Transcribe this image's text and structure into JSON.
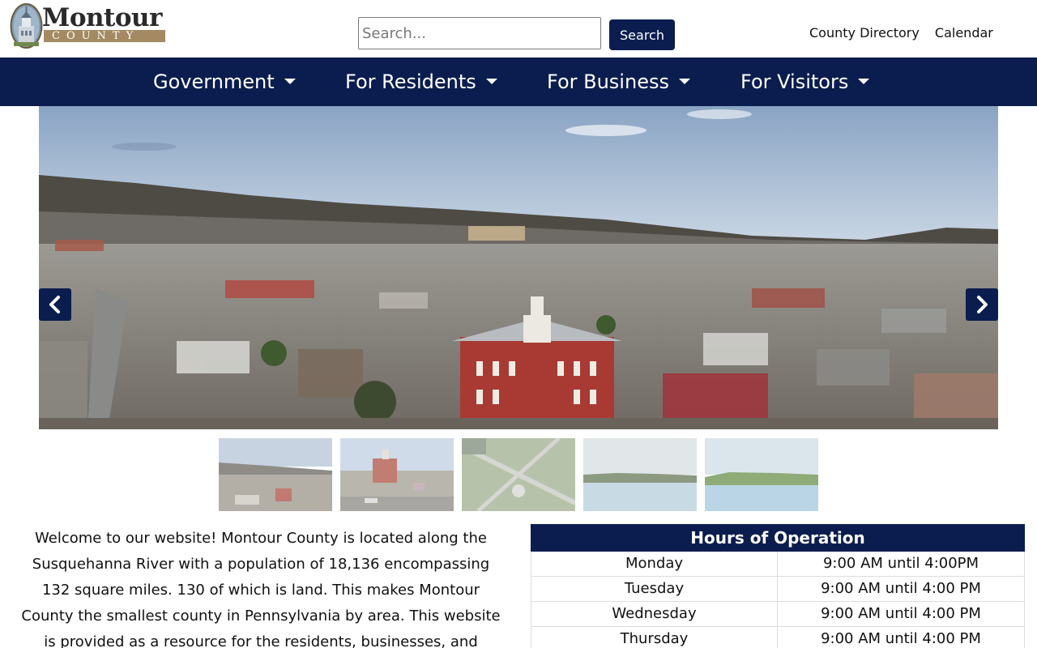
{
  "header": {
    "logo_title": "Montour",
    "logo_subtitle": "COUNTY",
    "search_placeholder": "Search...",
    "search_button": "Search",
    "links": [
      "County Directory",
      "Calendar"
    ]
  },
  "nav": {
    "items": [
      "Government",
      "For Residents",
      "For Business",
      "For Visitors"
    ]
  },
  "carousel": {
    "prev_icon": "chevron-left-icon",
    "next_icon": "chevron-right-icon",
    "thumbnail_count": 5
  },
  "welcome": {
    "lines": [
      "Welcome to our website!  Montour County is located along the",
      "Susquehanna River with a population of 18,136 encompassing",
      "132 square miles. 130 of which is land.  This makes Montour",
      "County the smallest county in Pennsylvania by area.  This website",
      "is provided as a resource for the residents, businesses, and"
    ]
  },
  "hours": {
    "title": "Hours of Operation",
    "rows": [
      {
        "day": "Monday",
        "time": "9:00 AM until 4:00PM"
      },
      {
        "day": "Tuesday",
        "time": "9:00 AM until 4:00 PM"
      },
      {
        "day": "Wednesday",
        "time": "9:00 AM until 4:00 PM"
      },
      {
        "day": "Thursday",
        "time": "9:00 AM until 4:00 PM"
      }
    ]
  },
  "colors": {
    "navy": "#0b1d4f",
    "logo_gold": "#a48a62"
  }
}
